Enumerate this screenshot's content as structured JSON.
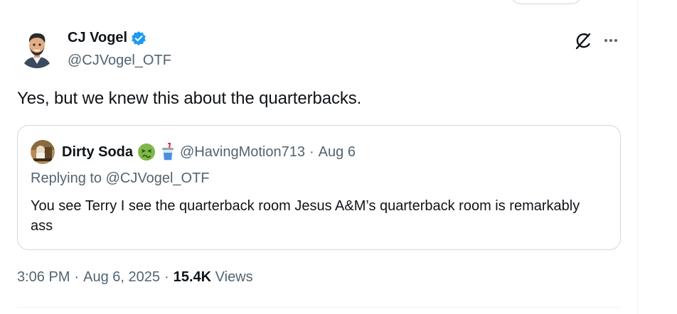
{
  "colors": {
    "text_primary": "#0f1419",
    "text_secondary": "#536471",
    "border": "#cfd9de",
    "verified_blue": "#1d9bf0"
  },
  "post": {
    "author": {
      "name": "CJ Vogel",
      "handle": "@CJVogel_OTF",
      "verified": true
    },
    "text": "Yes, but we knew this about the quarterbacks.",
    "icons": {
      "grok": "grok-icon",
      "more": "more-icon"
    },
    "quote": {
      "author_name": "Dirty Soda",
      "handle": "@HavingMotion713",
      "separator": "·",
      "date": "Aug 6",
      "replying_to": "Replying to @CJVogel_OTF",
      "text": "You see Terry I see the quarterback room Jesus A&M’s quarterback room is remarkably ass"
    },
    "meta": {
      "time": "3:06 PM",
      "separator1": "·",
      "date": "Aug 6, 2025",
      "separator2": "·",
      "views_count": "15.4K",
      "views_label": "Views"
    }
  }
}
